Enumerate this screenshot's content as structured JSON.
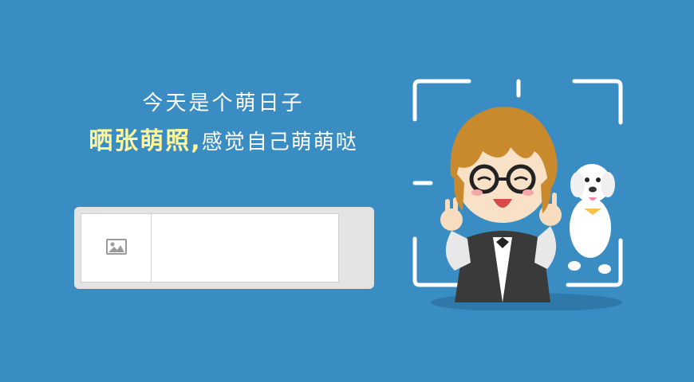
{
  "headline": {
    "line1": "今天是个萌日子",
    "line2_highlight": "晒张萌照,",
    "line2_rest": "感觉自己萌萌哒"
  },
  "upload": {
    "placeholder_icon": "image-icon"
  },
  "illustration": {
    "character": "chibi-boy-with-glasses",
    "pet": "white-puppy"
  },
  "colors": {
    "background": "#3a8dc2",
    "highlight": "#fff59a",
    "panel": "#e3e3e3"
  }
}
